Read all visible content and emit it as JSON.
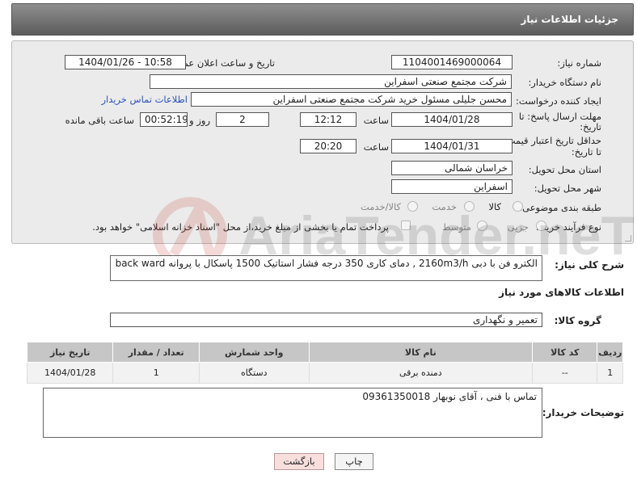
{
  "header": {
    "title": "جزئیات اطلاعات نیاز"
  },
  "form": {
    "need_number": {
      "label": "شماره نیاز:",
      "value": "1104001469000064"
    },
    "announce_datetime": {
      "label": "تاریخ و ساعت اعلان عمومی:",
      "value": "1404/01/26 - 10:58"
    },
    "buyer_org": {
      "label": "نام دستگاه خریدار:",
      "value": "شرکت مجتمع صنعتی اسفراین"
    },
    "requester": {
      "label": "ایجاد کننده درخواست:",
      "value": "محسن جلیلی مسئول خرید شرکت مجتمع صنعتی اسفراین",
      "contact_link": "اطلاعات تماس خریدار"
    },
    "reply_deadline": {
      "label_line1": "مهلت ارسال پاسخ: تا",
      "label_line2": "تاریخ:",
      "date": "1404/01/28",
      "time_label": "ساعت",
      "time": "12:12",
      "days": "2",
      "days_label": "روز و",
      "remaining": "00:52:19",
      "remaining_label": "ساعت باقی مانده"
    },
    "price_validity": {
      "label_line1": "حداقل تاریخ اعتبار قیمت:",
      "label_line2": "تا تاریخ:",
      "date": "1404/01/31",
      "time_label": "ساعت",
      "time": "20:20"
    },
    "delivery_province": {
      "label": "استان محل تحویل:",
      "value": "خراسان شمالی"
    },
    "delivery_city": {
      "label": "شهر محل تحویل:",
      "value": "اسفراین"
    },
    "category": {
      "label": "طبقه بندی موضوعی:",
      "options": [
        "کالا",
        "خدمت",
        "کالا/خدمت"
      ]
    },
    "process_type": {
      "label": "نوع فرآیند خرید :",
      "options": [
        "جزیی",
        "متوسط"
      ],
      "payment_note": "پرداخت تمام یا بخشی از مبلغ خرید،از محل \"اسناد خزانه اسلامی\" خواهد بود."
    }
  },
  "general_description": {
    "label": "شرح کلی نیاز:",
    "value": "الکترو فن با دبی 2160m3/h , دمای کاری 350 درجه فشار استاتیک 1500 پاسکال با پروانه back ward"
  },
  "goods_section": {
    "title": "اطلاعات کالاهای مورد نیاز",
    "group_label": "گروه کالا:",
    "group_value": "تعمیر و نگهداری"
  },
  "table": {
    "headers": [
      "ردیف",
      "کد کالا",
      "نام کالا",
      "واحد شمارش",
      "تعداد / مقدار",
      "تاریخ نیاز"
    ],
    "rows": [
      [
        "1",
        "--",
        "دمنده برقی",
        "دستگاه",
        "1",
        "1404/01/28"
      ]
    ]
  },
  "buyer_notes": {
    "label": "توضیحات خریدار:",
    "value": "تماس با فنی ، آقای نوبهار 09361350018"
  },
  "buttons": {
    "print": "چاپ",
    "back": "بازگشت"
  },
  "watermark": {
    "text": "AriaTender.neT"
  },
  "colors": {
    "header_bg": "#6e6e6e",
    "link": "#2a52be",
    "back_button_bg": "#f9dede"
  }
}
